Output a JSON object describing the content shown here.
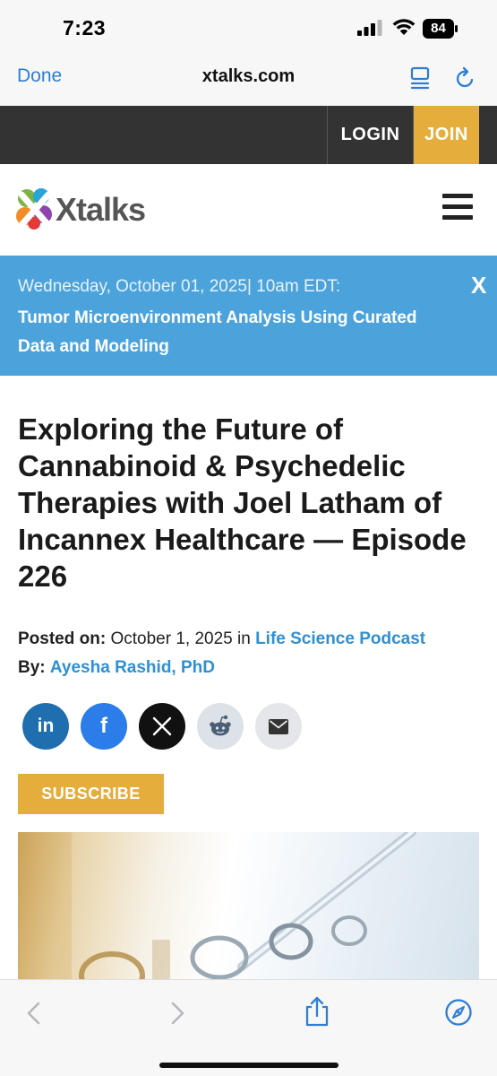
{
  "status_bar": {
    "time": "7:23",
    "battery": "84"
  },
  "browser": {
    "done_label": "Done",
    "url": "xtalks.com"
  },
  "topnav": {
    "login_label": "LOGIN",
    "join_label": "JOIN"
  },
  "header": {
    "logo_text": "Xtalks"
  },
  "banner": {
    "date": "Wednesday, October 01, 2025| 10am EDT:",
    "title": "Tumor Microenvironment Analysis Using Curated Data and Modeling",
    "close_label": "X"
  },
  "article": {
    "headline": "Exploring the Future of Cannabinoid & Psychedelic Therapies with Joel Latham of Incannex Healthcare — Episode 226",
    "posted_label": "Posted on:",
    "posted_date": "October 1, 2025 in",
    "category": "Life Science Podcast",
    "by_label": "By:",
    "author": "Ayesha Rashid, PhD",
    "subscribe_label": "SUBSCRIBE"
  },
  "share": {
    "linkedin": "in",
    "facebook": "f",
    "x": "𝕏"
  },
  "colors": {
    "accent_gold": "#e5ae3c",
    "banner_blue": "#4ca3dc",
    "link_blue": "#2f8fd0",
    "ios_blue": "#2f7dd3",
    "dark_nav": "#333333"
  }
}
